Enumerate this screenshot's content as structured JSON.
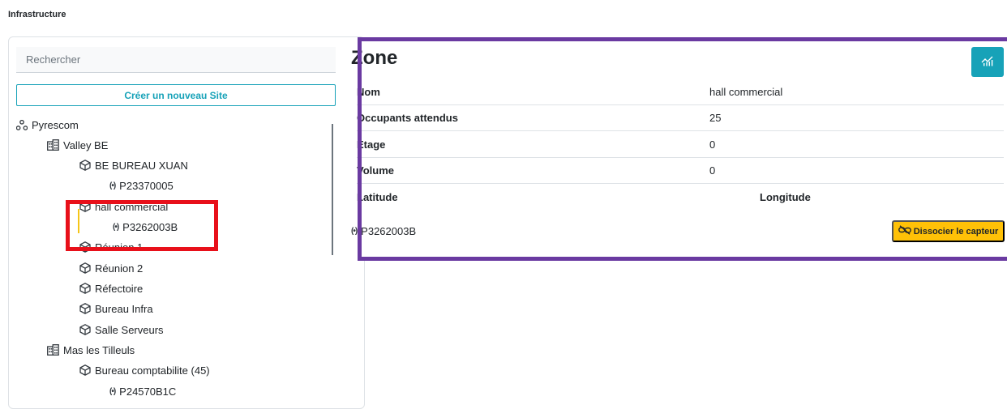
{
  "page": {
    "title": "Infrastructure"
  },
  "tree": {
    "search_placeholder": "Rechercher",
    "create_button": "Créer un nouveau Site",
    "items": [
      {
        "type": "company",
        "icon": "network-icon",
        "label": "Pyrescom"
      },
      {
        "type": "site",
        "icon": "building-icon",
        "label": "Valley BE"
      },
      {
        "type": "zone",
        "icon": "cube-icon",
        "label": "BE BUREAU XUAN"
      },
      {
        "type": "sensor",
        "icon": "sensor-icon",
        "label": "P23370005"
      },
      {
        "type": "zone",
        "icon": "cube-icon",
        "label": "hall commercial"
      },
      {
        "type": "sensor",
        "icon": "sensor-icon",
        "label": "P3262003B"
      },
      {
        "type": "zone",
        "icon": "cube-icon",
        "label": "Réunion 1"
      },
      {
        "type": "zone",
        "icon": "cube-icon",
        "label": "Réunion 2"
      },
      {
        "type": "zone",
        "icon": "cube-icon",
        "label": "Réfectoire"
      },
      {
        "type": "zone",
        "icon": "cube-icon",
        "label": "Bureau Infra"
      },
      {
        "type": "zone",
        "icon": "cube-icon",
        "label": "Salle Serveurs"
      },
      {
        "type": "site",
        "icon": "building-icon",
        "label": "Mas les Tilleuls"
      },
      {
        "type": "zone",
        "icon": "cube-icon",
        "label": "Bureau comptabilite (45)"
      },
      {
        "type": "sensor",
        "icon": "sensor-icon",
        "label": "P24570B1C"
      }
    ]
  },
  "zone": {
    "title": "Zone",
    "fields": [
      {
        "label": "Nom",
        "value": "hall commercial"
      },
      {
        "label": "Occupants attendus",
        "value": "25"
      },
      {
        "label": "Etage",
        "value": "0"
      },
      {
        "label": "Volume",
        "value": "0"
      }
    ],
    "latitude_label": "Latitude",
    "longitude_label": "Longitude",
    "sensor_label": "P3262003B",
    "dissociate_button": "Dissocier le capteur"
  },
  "colors": {
    "accent": "#17a2b8",
    "warning": "#ffc107",
    "highlight_red": "#e8101a",
    "highlight_purple": "#6a3aa1"
  }
}
